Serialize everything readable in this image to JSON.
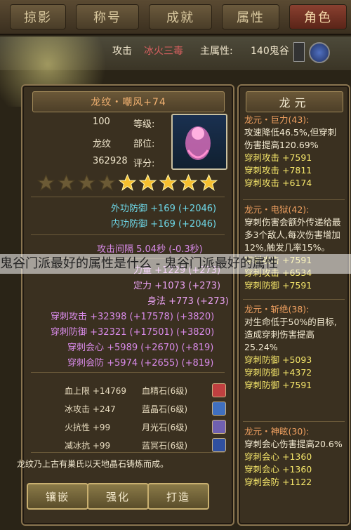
{
  "top_tabs": [
    "掠影",
    "称号",
    "成就",
    "属性",
    "角色"
  ],
  "header": {
    "level_label": "140鬼谷",
    "main_attr_label": "主属性:",
    "main_attr_value": "冰火三毒",
    "attack_label": "攻击"
  },
  "item": {
    "name": "龙纹・嘲风+74",
    "level_label": "等级:",
    "level_value": "100",
    "slot_label": "部位:",
    "slot_value": "龙纹",
    "score_label": "评分:",
    "score_value": "362928",
    "stars_total": 9,
    "stars_lit": 5
  },
  "defense_stats": [
    {
      "text": "外功防御 +169 (+2046)"
    },
    {
      "text": "内功防御 +169 (+2046)"
    }
  ],
  "interval": "攻击间隔 5.04秒 (-0.3秒)",
  "base_stats": [
    {
      "text": "力量 +1229 (+273)"
    },
    {
      "text": "定力 +1073 (+273)"
    },
    {
      "text": "身法 +773 (+273)"
    }
  ],
  "pierce_stats": [
    {
      "text": "穿刺攻击 +32398 (+17578) (+3820)"
    },
    {
      "text": "穿刺防御 +32321 (+17501) (+3820)"
    },
    {
      "text": "穿刺会心 +5989 (+2670) (+819)"
    },
    {
      "text": "穿刺会防 +5974 (+2655) (+819)"
    }
  ],
  "gems": [
    {
      "name": "血精石(6级)",
      "effect": "血上限 +14769",
      "color": "#c04040"
    },
    {
      "name": "蓝晶石(6级)",
      "effect": "冰攻击 +247",
      "color": "#4070c0"
    },
    {
      "name": "月光石(6级)",
      "effect": "火抗性 +99",
      "color": "#7060b0"
    },
    {
      "name": "蓝冥石(6级)",
      "effect": "减冰抗 +99",
      "color": "#3050a0"
    }
  ],
  "description": "龙纹乃上古有巢氏以天地晶石铸炼而成。",
  "buttons": [
    "打造",
    "强化",
    "镶嵌"
  ],
  "side": {
    "title": "龙元",
    "skills": [
      {
        "name": "龙元・巨力(43):",
        "desc": "攻速降低46.5%,但穿刺伤害提高120.69%",
        "stats": [
          "穿刺攻击 +7591",
          "穿刺攻击 +7811",
          "穿刺攻击 +6174"
        ]
      },
      {
        "name": "龙元・电狱(42):",
        "desc": "穿刺伤害会额外传递给最多3个敌人,每次伤害增加12%,触发几率15%。",
        "stats": [
          "穿刺攻击 +7591",
          "穿刺攻击 +6534",
          "穿刺防御 +7591"
        ]
      },
      {
        "name": "龙元・斩绝(38):",
        "desc": "对生命低于50%的目标,造成穿刺伤害提高25.24%",
        "stats": [
          "穿刺防御 +5093",
          "穿刺防御 +4372",
          "穿刺防御 +7591"
        ]
      },
      {
        "name": "龙元・神眩(30):",
        "desc": "穿刺会心伤害提高20.6%",
        "stats": [
          "穿刺会心 +1360",
          "穿刺会心 +1360",
          "穿刺会防 +1122"
        ]
      }
    ]
  },
  "watermark": "鬼谷门派最好的属性是什么 - 鬼谷门派最好的属性"
}
